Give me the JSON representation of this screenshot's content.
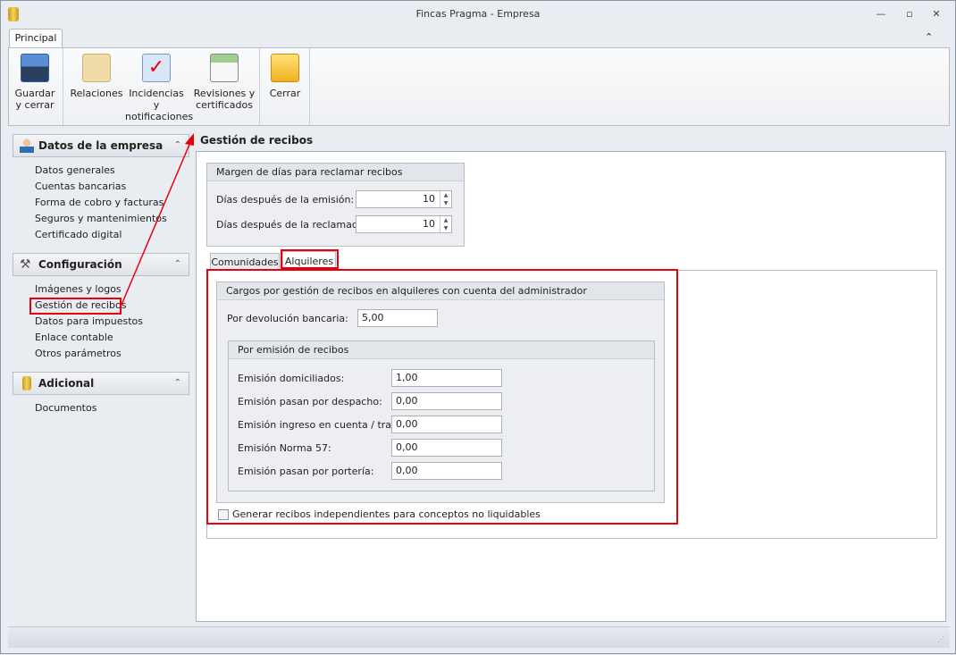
{
  "window": {
    "title": "Fincas Pragma - Empresa",
    "minimize": "—",
    "restore": "▫",
    "close": "✕"
  },
  "ribbon": {
    "tab": "Principal",
    "collapse": "⌃",
    "buttons": [
      {
        "label1": "Guardar",
        "label2": "y cerrar"
      },
      {
        "label1": "Relaciones",
        "label2": ""
      },
      {
        "label1": "Incidencias y",
        "label2": "notificaciones"
      },
      {
        "label1": "Revisiones y",
        "label2": "certificados"
      },
      {
        "label1": "Cerrar",
        "label2": ""
      }
    ]
  },
  "sidebar": {
    "groups": [
      {
        "title": "Datos de la empresa",
        "items": [
          "Datos generales",
          "Cuentas bancarias",
          "Forma de cobro y facturas",
          "Seguros y mantenimientos",
          "Certificado digital"
        ]
      },
      {
        "title": "Configuración",
        "items": [
          "Imágenes y logos",
          "Gestión de recibos",
          "Datos para impuestos",
          "Enlace contable",
          "Otros parámetros"
        ]
      },
      {
        "title": "Adicional",
        "items": [
          "Documentos"
        ]
      }
    ],
    "chevron": "⌃"
  },
  "main": {
    "title": "Gestión de recibos",
    "margin": {
      "title": "Margen de días para reclamar recibos",
      "fields": [
        {
          "label": "Días después de la emisión:",
          "value": "10"
        },
        {
          "label": "Días después de la reclamación:",
          "value": "10"
        }
      ]
    },
    "tabs": [
      "Comunidades",
      "Alquileres"
    ],
    "cargos": {
      "title": "Cargos por gestión de recibos en alquileres con cuenta del administrador",
      "devolucion_label": "Por devolución bancaria:",
      "devolucion_value": "5,00",
      "emision": {
        "title": "Por emisión de recibos",
        "fields": [
          {
            "label": "Emisión domiciliados:",
            "value": "1,00"
          },
          {
            "label": "Emisión pasan por despacho:",
            "value": "0,00"
          },
          {
            "label": "Emisión ingreso en cuenta / transf:",
            "value": "0,00"
          },
          {
            "label": "Emisión Norma 57:",
            "value": "0,00"
          },
          {
            "label": "Emisión pasan por portería:",
            "value": "0,00"
          }
        ]
      }
    },
    "checkbox_label": "Generar recibos independientes para conceptos no liquidables"
  }
}
